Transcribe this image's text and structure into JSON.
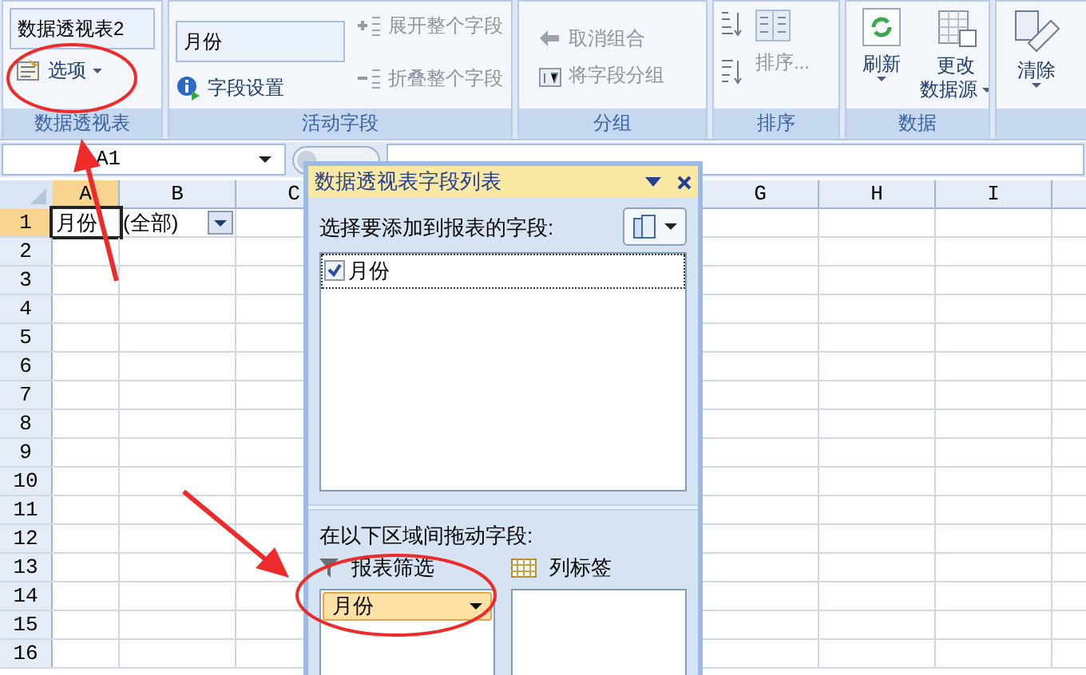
{
  "ribbon": {
    "groups": [
      {
        "kind": "pivot",
        "label": "数据透视表",
        "name_field": "数据透视表2",
        "options_button": "选项"
      },
      {
        "kind": "field",
        "label": "活动字段",
        "field_value": "月份",
        "settings_button": "字段设置",
        "commands": [
          {
            "label": "展开整个字段",
            "disabled": true
          },
          {
            "label": "折叠整个字段",
            "disabled": true
          }
        ]
      },
      {
        "kind": "group",
        "label": "分组",
        "commands": [
          {
            "label": "取消组合",
            "disabled": true
          },
          {
            "label": "将字段分组",
            "disabled": true
          }
        ]
      },
      {
        "kind": "sort",
        "label": "排序",
        "sort_button": "排序...",
        "disabled": true
      },
      {
        "kind": "data",
        "label": "数据",
        "buttons": [
          {
            "label": "刷新"
          },
          {
            "label": "更改",
            "label_2": "数据源"
          }
        ]
      },
      {
        "kind": "clear",
        "buttons": [
          {
            "label": "清除"
          }
        ]
      }
    ]
  },
  "formula_bar": {
    "name_box": "A1"
  },
  "sheet": {
    "columns": [
      {
        "label": "A",
        "selected": true
      },
      {
        "label": "B",
        "selected": false
      },
      {
        "label": "C",
        "selected": false
      },
      {
        "label": "G",
        "selected": false
      },
      {
        "label": "H",
        "selected": false
      },
      {
        "label": "I",
        "selected": false
      }
    ],
    "rows": [
      {
        "label": "1",
        "selected": true,
        "cells": [
          {
            "text": "月份",
            "selected": true
          },
          {
            "text": "(全部)",
            "selected": false,
            "dropdown": true
          }
        ]
      },
      {
        "label": "2",
        "selected": false
      },
      {
        "label": "3",
        "selected": false
      },
      {
        "label": "4",
        "selected": false
      },
      {
        "label": "5",
        "selected": false
      },
      {
        "label": "6",
        "selected": false
      },
      {
        "label": "7",
        "selected": false
      },
      {
        "label": "8",
        "selected": false
      },
      {
        "label": "9",
        "selected": false
      },
      {
        "label": "10",
        "selected": false
      },
      {
        "label": "11",
        "selected": false
      },
      {
        "label": "12",
        "selected": false
      },
      {
        "label": "13",
        "selected": false
      },
      {
        "label": "14",
        "selected": false
      },
      {
        "label": "15",
        "selected": false
      },
      {
        "label": "16",
        "selected": false
      }
    ]
  },
  "field_list": {
    "title": "数据透视表字段列表",
    "prompt": "选择要添加到报表的字段:",
    "fields": [
      {
        "label": "月份",
        "checked": true
      }
    ],
    "drag_prompt": "在以下区域间拖动字段:",
    "areas": [
      {
        "kind": "filter",
        "label": "报表筛选",
        "items": [
          "月份"
        ]
      },
      {
        "kind": "columns",
        "label": "列标签"
      }
    ]
  }
}
